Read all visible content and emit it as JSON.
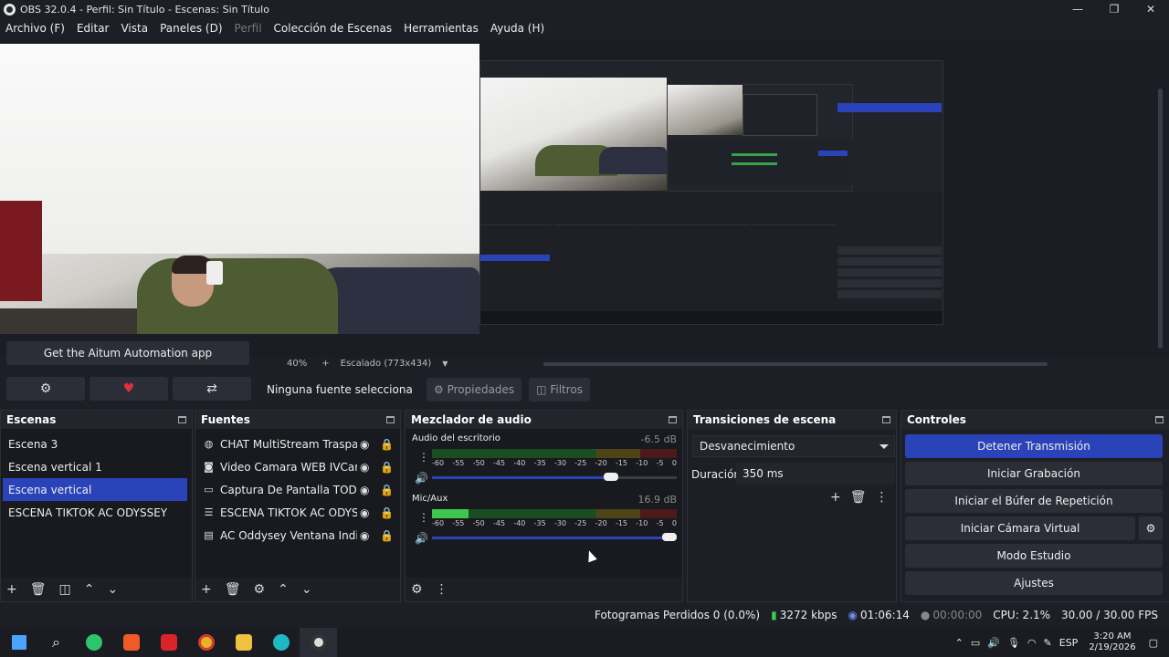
{
  "window": {
    "title": "OBS 32.0.4 - Perfil: Sin Título - Escenas: Sin Título",
    "minimize": "—",
    "maximize": "❐",
    "close": "✕"
  },
  "menu": [
    "Archivo (F)",
    "Editar",
    "Vista",
    "Paneles (D)",
    "Perfil",
    "Colección de Escenas",
    "Herramientas",
    "Ayuda (H)"
  ],
  "preview": {
    "zoom": "40%",
    "zoom_plus": "+",
    "scale_label": "Escalado (773x434)"
  },
  "aitum": {
    "app_button": "Get the Aitum Automation app"
  },
  "source_bar": {
    "label": "Ninguna fuente selecciona",
    "properties": "Propiedades",
    "filters": "Filtros"
  },
  "scenes": {
    "title": "Escenas",
    "items": [
      "Escena 3",
      "Escena vertical 1",
      "Escena vertical",
      "ESCENA TIKTOK AC ODYSSEY"
    ],
    "selected": "Escena vertical"
  },
  "sources": {
    "title": "Fuentes",
    "items": [
      {
        "name": "CHAT MultiStream Trasparent",
        "icon": "globe-icon"
      },
      {
        "name": "Video Camara WEB IVCam Drc",
        "icon": "camera-icon"
      },
      {
        "name": "Captura De Pantalla TODO \"nc",
        "icon": "monitor-icon"
      },
      {
        "name": "ESCENA TIKTOK AC ODYSSEY",
        "icon": "list-icon"
      },
      {
        "name": "AC Oddysey Ventana Individu",
        "icon": "window-icon"
      }
    ]
  },
  "mixer": {
    "title": "Mezclador de audio",
    "scale": [
      "-60",
      "-55",
      "-50",
      "-45",
      "-40",
      "-35",
      "-30",
      "-25",
      "-20",
      "-15",
      "-10",
      "-5",
      "0"
    ],
    "channels": [
      {
        "name": "Audio del escritorio",
        "db": "-6.5 dB",
        "level": 0.0,
        "volume": 0.73
      },
      {
        "name": "Mic/Aux",
        "db": "16.9 dB",
        "level": 0.15,
        "volume": 0.98
      }
    ]
  },
  "transitions": {
    "title": "Transiciones de escena",
    "selected": "Desvanecimiento",
    "duration_label": "Duración",
    "duration_value": "350 ms"
  },
  "controls": {
    "title": "Controles",
    "buttons": [
      "Detener Transmisión",
      "Iniciar Grabación",
      "Iniciar el Búfer de Repetición",
      "Iniciar Cámara Virtual",
      "Modo Estudio",
      "Ajustes"
    ]
  },
  "status": {
    "dropped": "Fotogramas Perdidos 0 (0.0%)",
    "bitrate": "3272 kbps",
    "live_time": "01:06:14",
    "rec_time": "00:00:00",
    "cpu": "CPU: 2.1%",
    "fps": "30.00 / 30.00 FPS"
  },
  "taskbar": {
    "lang": "ESP",
    "time": "3:20 AM",
    "date": "2/19/2026"
  },
  "colors": {
    "accent": "#2a43b8",
    "meter_green": "#3fc74f",
    "panel_bg": "#1d1f26"
  }
}
